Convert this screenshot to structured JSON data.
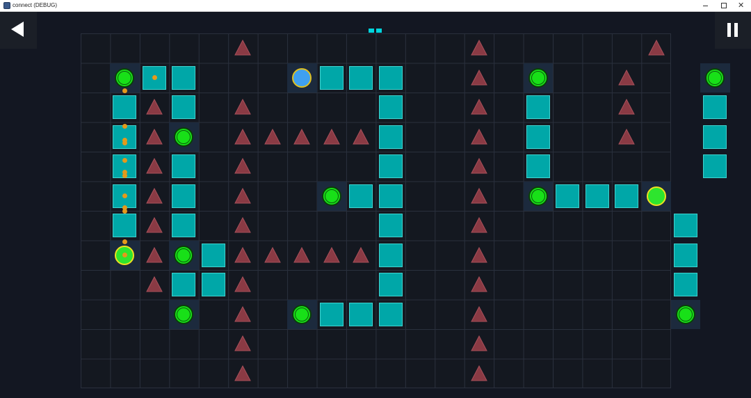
{
  "window": {
    "title": "connect (DEBUG)",
    "controls": [
      "minimize",
      "maximize",
      "close"
    ]
  },
  "toolbar": {
    "back_icon": "back-arrow-icon",
    "pause_icon": "pause-icon"
  },
  "progress": {
    "total": 2,
    "filled": 2,
    "color": "#00d5dd"
  },
  "colors": {
    "background": "#131722",
    "block": "#00a7a8",
    "spike": "#8a3a44",
    "node_green": "#18e018",
    "node_start": "#3fa0f0",
    "node_goal_outline": "#f0e020",
    "path_dot": "#e39a1b"
  },
  "board": {
    "cols": 20,
    "rows": 12,
    "legend": {
      ".": "empty",
      "#": "block",
      "^": "spike",
      "G": "green-node",
      "B": "blue-node",
      "Y": "yellow-node"
    },
    "grid": [
      ".....^.......^.....^..",
      ".G##...B###..^.G..^..G",
      ".#^#.^....#..^.#..^..#",
      ".#^G.^^^^^#..^.#..^..#",
      ".#^#.^....#..^.#.....#",
      ".#^#.^..G##..^.G###Y",
      ".#^#.^....#..^......#",
      ".Y^G#^^^^^#..^......#",
      "..^##^....#..^......#",
      "...G.^.G###..^......G",
      ".....^.......^......",
      ".....^.......^......"
    ],
    "path_dots": [
      {
        "col": 2,
        "row": 1,
        "dy": 0
      },
      {
        "col": 1,
        "row": 1,
        "dy": 0.45
      },
      {
        "col": 1,
        "row": 3,
        "dy": -0.35
      },
      {
        "col": 1,
        "row": 3,
        "dy": 0.1
      },
      {
        "col": 1,
        "row": 3,
        "dy": 0.2
      },
      {
        "col": 1,
        "row": 4,
        "dy": -0.2
      },
      {
        "col": 1,
        "row": 4,
        "dy": 0.2
      },
      {
        "col": 1,
        "row": 4,
        "dy": 0.3
      },
      {
        "col": 1,
        "row": 5,
        "dy": 0
      },
      {
        "col": 1,
        "row": 5,
        "dy": 0.4
      },
      {
        "col": 1,
        "row": 5,
        "dy": 0.5
      },
      {
        "col": 1,
        "row": 7,
        "dy": -0.45
      },
      {
        "col": 1,
        "row": 7,
        "dy": 0
      }
    ]
  }
}
